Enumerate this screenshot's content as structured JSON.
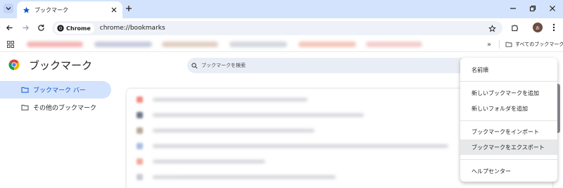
{
  "browser": {
    "tab": {
      "title": "ブックマーク",
      "icon": "star-icon"
    },
    "new_tab_symbol": "+",
    "omnibox": {
      "chip_label": "Chrome",
      "url": "chrome://bookmarks"
    },
    "avatar_initial": "お"
  },
  "bookmarks_bar": {
    "overflow": "»",
    "all_bookmarks_label": "すべてのブックマーク"
  },
  "page": {
    "title": "ブックマーク",
    "search_placeholder": "ブックマークを検索"
  },
  "sidebar": {
    "items": [
      {
        "label": "ブックマーク バー",
        "icon": "folder-icon",
        "selected": true
      },
      {
        "label": "その他のブックマーク",
        "icon": "folder-icon",
        "selected": false
      }
    ]
  },
  "sort_menu": {
    "items": [
      {
        "label": "名前順"
      },
      {
        "label": "新しいブックマークを追加"
      },
      {
        "label": "新しいフォルダを追加"
      },
      {
        "label": "ブックマークをインポート"
      },
      {
        "label": "ブックマークをエクスポート",
        "hovered": true
      },
      {
        "label": "ヘルプセンター"
      }
    ]
  },
  "colors": {
    "titlebar": "#d3e3fd",
    "accent": "#0b57d0",
    "selected_bg": "#d3e3fd",
    "menu_hover": "#e7e8ea"
  }
}
